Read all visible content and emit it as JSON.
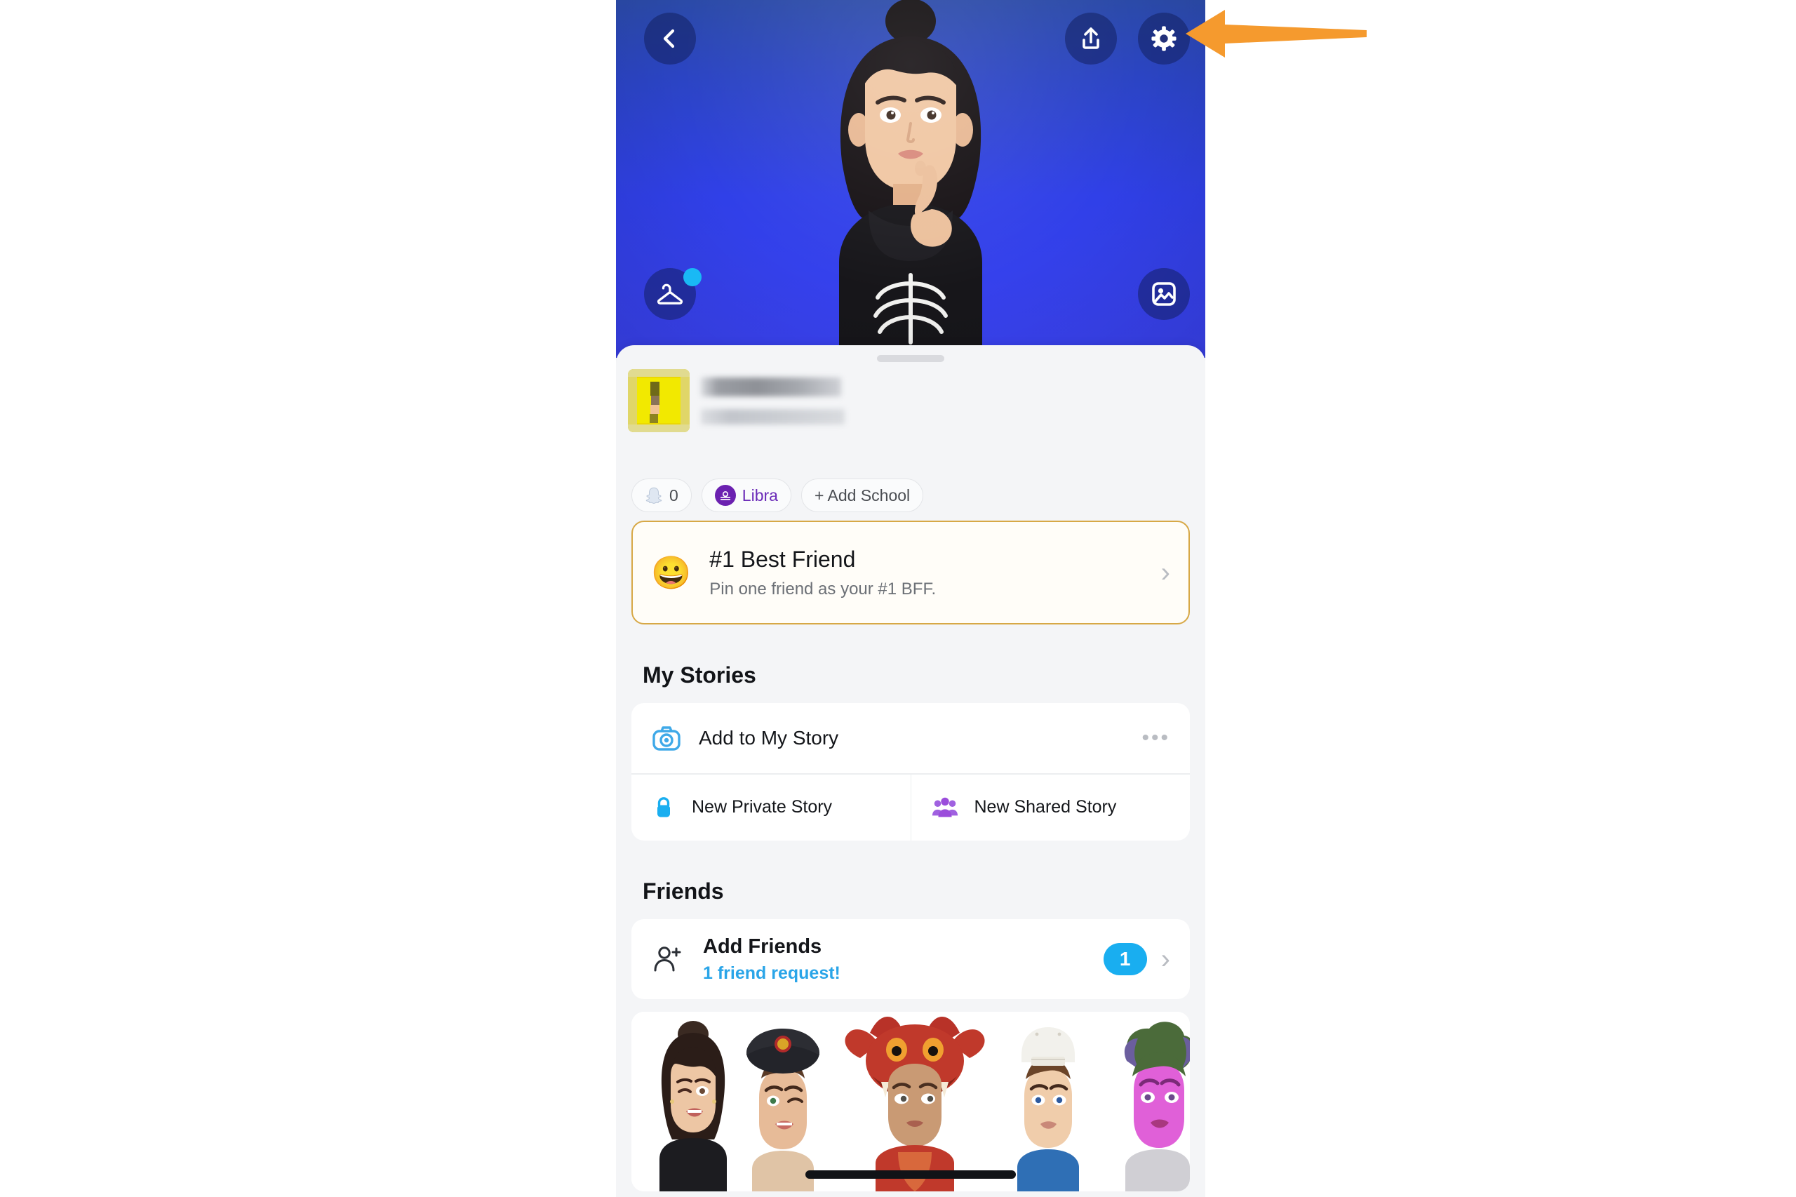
{
  "app": {
    "screen_title": "Snapchat Profile",
    "platform": "mobile"
  },
  "header": {
    "back_icon": "chevron-left-icon",
    "share_icon": "share-upload-icon",
    "settings_icon": "gear-icon",
    "wardrobe_icon": "clothing-hanger-icon",
    "wardrobe_has_notification": true,
    "backdrop_icon": "photo-frame-icon",
    "gradient_top": "#2b4aa8",
    "gradient_bottom": "#3a42f0",
    "button_bg": "rgba(16,28,88,0.50)",
    "notification_dot_color": "#19b9f5"
  },
  "annotation": {
    "type": "arrow",
    "color": "#F59A2E",
    "points_to": "settings-gear-button",
    "direction": "left"
  },
  "profile": {
    "snapcode_color": "#ecd900",
    "display_name": "",
    "username": "",
    "name_redacted": true,
    "username_redacted": true,
    "badges": [
      {
        "name": "snapscore",
        "icon": "snapchat-ghost-icon",
        "label": "0"
      },
      {
        "name": "zodiac",
        "icon": "libra-zodiac-icon",
        "label": "Libra",
        "color": "#6b21b0"
      },
      {
        "name": "add-school",
        "icon": "plus-icon",
        "label": "+ Add School"
      }
    ]
  },
  "best_friend_card": {
    "emoji": "😀",
    "title": "#1 Best Friend",
    "subtitle": "Pin one friend as your #1 BFF.",
    "chevron": "›",
    "border_color": "#d7a846"
  },
  "my_stories": {
    "heading": "My Stories",
    "add_story": {
      "icon": "camera-icon",
      "label": "Add to My Story",
      "overflow": "•••",
      "icon_color": "#3fa9e8"
    },
    "private_story": {
      "icon": "lock-icon",
      "label": "New Private Story",
      "icon_color": "#19aef0"
    },
    "shared_story": {
      "icon": "group-people-icon",
      "label": "New Shared Story",
      "icon_color": "#9b4ddb"
    }
  },
  "friends": {
    "heading": "Friends",
    "add_friends": {
      "icon": "person-add-icon",
      "title": "Add Friends",
      "subtitle": "1 friend request!",
      "badge_count": "1",
      "badge_color": "#19aef0",
      "subtitle_color": "#2aa5e8",
      "chevron": "›"
    }
  },
  "bitmoji_strip": {
    "label": "bitmoji-friends-carousel",
    "avatars": [
      {
        "name": "avatar-bun-winking",
        "hair": "#3a2a22",
        "skin": "#edc6a4"
      },
      {
        "name": "avatar-fire-helmet",
        "hair": "#5a3a26",
        "skin": "#e7bb98"
      },
      {
        "name": "avatar-dragon-hood",
        "hair": "#c0392b",
        "skin": "#c99a74"
      },
      {
        "name": "avatar-white-cap",
        "hair": "#6b4428",
        "skin": "#f0cdab"
      },
      {
        "name": "avatar-green-hair",
        "hair": "#4b6b3a",
        "skin": "#e060d8"
      }
    ]
  }
}
